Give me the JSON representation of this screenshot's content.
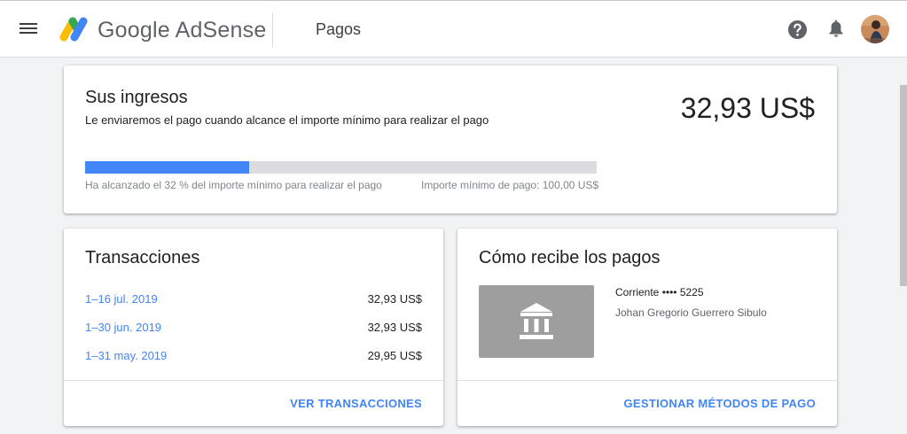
{
  "header": {
    "brand": "Google AdSense",
    "page_title": "Pagos",
    "icons": [
      "menu-icon",
      "adsense-logo-icon",
      "help-icon",
      "notifications-bell-icon",
      "avatar"
    ]
  },
  "earnings": {
    "title": "Sus ingresos",
    "subtitle": "Le enviaremos el pago cuando alcance el importe mínimo para realizar el pago",
    "amount": "32,93 US$",
    "progress_percent": 32,
    "progress_left_text": "Ha alcanzado el 32 % del importe mínimo para realizar el pago",
    "progress_right_text": "Importe mínimo de pago: 100,00 US$"
  },
  "transactions": {
    "title": "Transacciones",
    "rows": [
      {
        "period": "1–16 jul. 2019",
        "value": "32,93 US$"
      },
      {
        "period": "1–30 jun. 2019",
        "value": "32,93 US$"
      },
      {
        "period": "1–31 may. 2019",
        "value": "29,95 US$"
      }
    ],
    "action": "VER TRANSACCIONES"
  },
  "payments": {
    "title": "Cómo recibe los pagos",
    "account_line": "Corriente •••• 5225",
    "account_holder": "Johan Gregorio Guerrero Sibulo",
    "action": "GESTIONAR MÉTODOS DE PAGO"
  },
  "colors": {
    "accent": "#4285f4",
    "progress_track": "#dadce0",
    "bank_tile": "#9e9e9e",
    "background": "#f1f3f4"
  }
}
